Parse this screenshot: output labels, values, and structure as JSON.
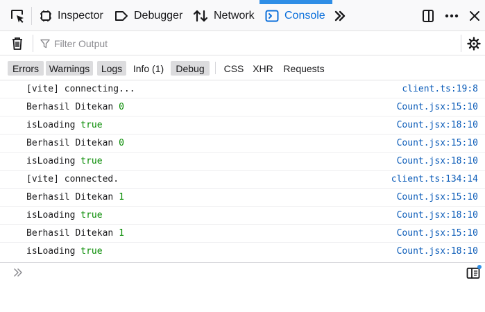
{
  "toolbar": {
    "tabs": [
      {
        "label": "Inspector",
        "icon": "inspector-icon"
      },
      {
        "label": "Debugger",
        "icon": "debugger-icon"
      },
      {
        "label": "Network",
        "icon": "network-icon"
      },
      {
        "label": "Console",
        "icon": "console-icon",
        "selected": true
      }
    ],
    "picker_icon": "element-picker-icon",
    "overflow_icon": "chevron-double-right-icon",
    "responsive_icon": "dock-side-icon",
    "more_icon": "more-options-icon",
    "close_icon": "close-icon"
  },
  "filter": {
    "placeholder": "Filter Output",
    "trash_icon": "trash-icon",
    "settings_icon": "gear-icon"
  },
  "levels": [
    {
      "label": "Errors",
      "active": true
    },
    {
      "label": "Warnings",
      "active": true
    },
    {
      "label": "Logs",
      "active": true
    },
    {
      "label": "Info (1)",
      "active": false
    },
    {
      "label": "Debug",
      "active": true
    }
  ],
  "types": [
    "CSS",
    "XHR",
    "Requests"
  ],
  "messages": [
    {
      "text": "[vite] connecting...",
      "value": "",
      "source": "client.ts:19:8"
    },
    {
      "text": "Berhasil Ditekan ",
      "value": "0",
      "source": "Count.jsx:15:10"
    },
    {
      "text": "isLoading ",
      "value": "true",
      "source": "Count.jsx:18:10"
    },
    {
      "text": "Berhasil Ditekan ",
      "value": "0",
      "source": "Count.jsx:15:10"
    },
    {
      "text": "isLoading ",
      "value": "true",
      "source": "Count.jsx:18:10"
    },
    {
      "text": "[vite] connected.",
      "value": "",
      "source": "client.ts:134:14"
    },
    {
      "text": "Berhasil Ditekan ",
      "value": "1",
      "source": "Count.jsx:15:10"
    },
    {
      "text": "isLoading ",
      "value": "true",
      "source": "Count.jsx:18:10"
    },
    {
      "text": "Berhasil Ditekan ",
      "value": "1",
      "source": "Count.jsx:15:10"
    },
    {
      "text": "isLoading ",
      "value": "true",
      "source": "Count.jsx:18:10"
    }
  ],
  "input": {
    "prompt": "»",
    "editor_icon": "editor-mode-icon"
  },
  "colors": {
    "accent": "#0a6fdb",
    "value_green": "#058b00",
    "link_blue": "#0a5bb8"
  }
}
